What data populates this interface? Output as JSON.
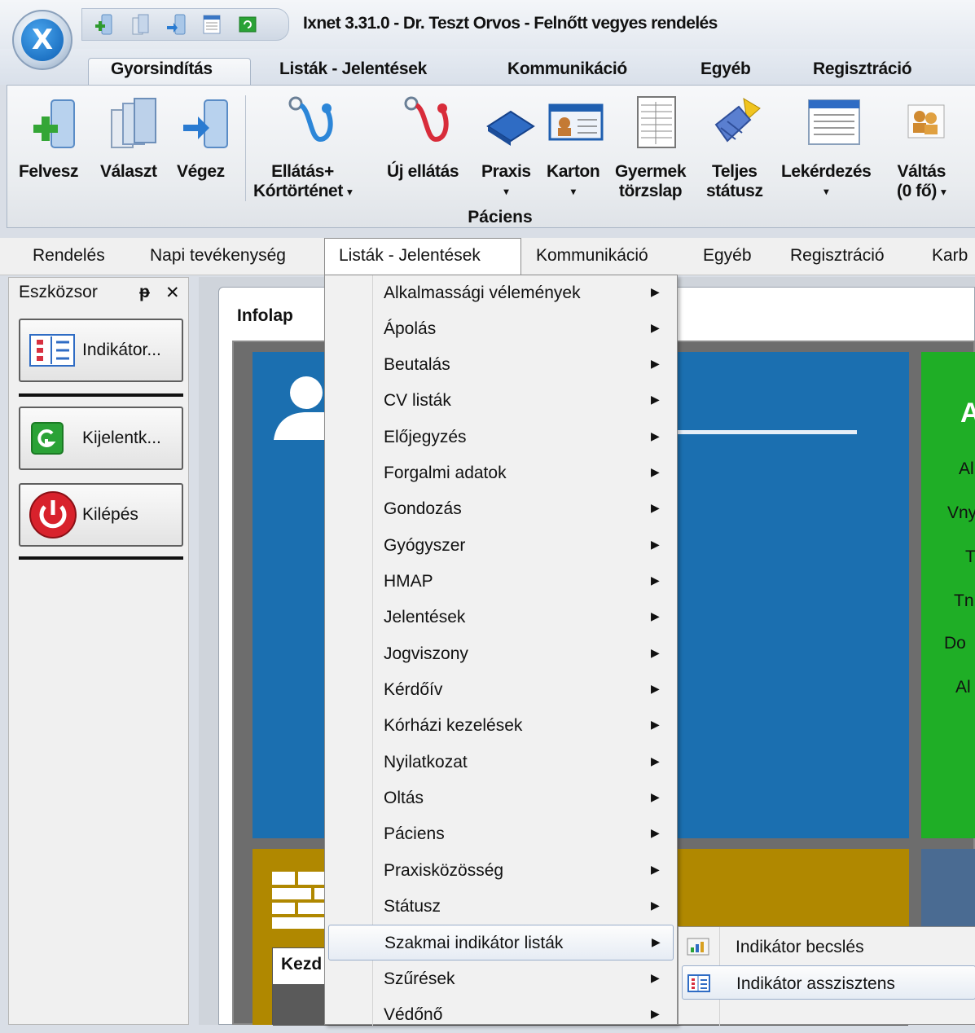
{
  "window": {
    "title": "Ixnet 3.31.0 - Dr. Teszt Orvos - Felnőtt vegyes rendelés",
    "logo_icon": "ixnet-logo-icon",
    "quick_access_icons": [
      "add-patient-icon",
      "select-patient-icon",
      "finish-patient-icon",
      "document-icon",
      "green-refresh-icon"
    ]
  },
  "ribbon_tabs": [
    "Gyorsindítás",
    "Listák - Jelentések",
    "Kommunikáció",
    "Egyéb",
    "Regisztráció"
  ],
  "ribbon_active_tab": "Gyorsindítás",
  "ribbon": {
    "group_label": "Páciens",
    "buttons": [
      {
        "label": "Felvesz",
        "icon": "add-patient-icon"
      },
      {
        "label": "Választ",
        "icon": "select-patient-icon"
      },
      {
        "label": "Végez",
        "icon": "finish-patient-icon"
      },
      {
        "label1": "Ellátás+",
        "label2": "Kórtörténet",
        "icon": "stethoscope-blue-icon"
      },
      {
        "label": "Új ellátás",
        "icon": "stethoscope-red-icon"
      },
      {
        "label": "Praxis",
        "icon": "book-icon"
      },
      {
        "label": "Karton",
        "icon": "id-card-icon"
      },
      {
        "label1": "Gyermek",
        "label2": "törzslap",
        "icon": "form-sheet-icon"
      },
      {
        "label1": "Teljes",
        "label2": "státusz",
        "icon": "broom-icon"
      },
      {
        "label": "Lekérdezés",
        "icon": "list-document-icon"
      },
      {
        "label1": "Váltás",
        "label2": "(0 fő)",
        "icon": "people-swap-icon"
      }
    ]
  },
  "menubar": [
    "Rendelés",
    "Napi tevékenység",
    "Listák - Jelentések",
    "Kommunikáció",
    "Egyéb",
    "Regisztráció",
    "Karb"
  ],
  "menubar_open": "Listák - Jelentések",
  "toolbox": {
    "title": "Eszközsor",
    "pin_glyph": "ᵽ",
    "close_glyph": "✕",
    "buttons": [
      {
        "label": "Indikátor...",
        "icon": "indicator-list-icon"
      },
      {
        "label": "Kijelentk...",
        "icon": "logout-green-icon"
      },
      {
        "label": "Kilépés",
        "icon": "power-red-icon"
      }
    ]
  },
  "content": {
    "tab_title": "Infolap",
    "kezd_label": "Kezd",
    "green_tile_labels": [
      "A",
      "Al",
      "Vny",
      "T",
      "Tn",
      "Do",
      "Al"
    ]
  },
  "dropdown": {
    "items": [
      "Alkalmassági vélemények",
      "Ápolás",
      "Beutalás",
      "CV listák",
      "Előjegyzés",
      "Forgalmi adatok",
      "Gondozás",
      "Gyógyszer",
      "HMAP",
      "Jelentések",
      "Jogviszony",
      "Kérdőív",
      "Kórházi kezelések",
      "Nyilatkozat",
      "Oltás",
      "Páciens",
      "Praxisközösség",
      "Státusz",
      "Szakmai indikátor listák",
      "Szűrések",
      "Védőnő"
    ],
    "highlighted": "Szakmai indikátor listák",
    "arrow_glyph": "▶"
  },
  "submenu": {
    "items": [
      {
        "label": "Indikátor becslés",
        "icon": "chart-estimate-icon"
      },
      {
        "label": "Indikátor asszisztens",
        "icon": "indicator-list-icon"
      }
    ],
    "highlighted": "Indikátor asszisztens"
  },
  "colors": {
    "tile_blue": "#1b6fb0",
    "tile_green": "#1fae26",
    "tile_gold": "#b08800",
    "tile_slate": "#4a6b92",
    "menu_highlight": "#e6ecf4"
  }
}
